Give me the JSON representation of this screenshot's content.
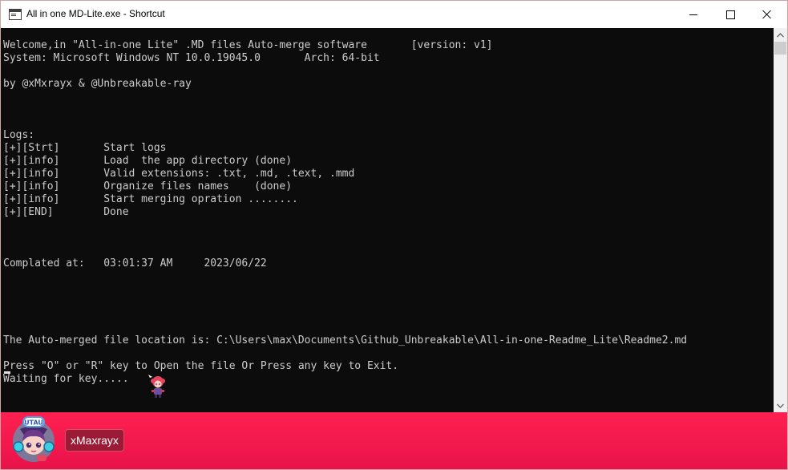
{
  "window": {
    "title": "All in one MD-Lite.exe - Shortcut"
  },
  "console": {
    "lines": [
      "Welcome,in \"All-in-one Lite\" .MD files Auto-merge software       [version: v1]",
      "System: Microsoft Windows NT 10.0.19045.0       Arch: 64-bit",
      "",
      "by @xMxrayx & @Unbreakable-ray",
      "",
      "",
      "",
      "Logs:",
      "[+][Strt]       Start logs",
      "[+][info]       Load  the app directory (done)",
      "[+][info]       Valid extensions: .txt, .md, .text, .mmd",
      "[+][info]       Organize files names    (done)",
      "[+][info]       Start merging opration ........",
      "[+][END]        Done",
      "",
      "",
      "",
      "Complated at:   03:01:37 AM     2023/06/22",
      "",
      "",
      "",
      "",
      "",
      "The Auto-merged file location is: C:\\Users\\max\\Documents\\Github_Unbreakable\\All-in-one-Readme_Lite\\Readme2.md",
      "",
      "Press \"O\" or \"R\" key to Open the file Or Press any key to Exit.",
      "Waiting for key....."
    ]
  },
  "taskbar": {
    "username": "xMaxrayx",
    "avatar_label": "UTAU",
    "color": "#ff2050"
  },
  "icons": {
    "app": "console-window-icon",
    "minimize": "minimize-icon",
    "maximize": "maximize-icon",
    "close": "close-icon"
  }
}
